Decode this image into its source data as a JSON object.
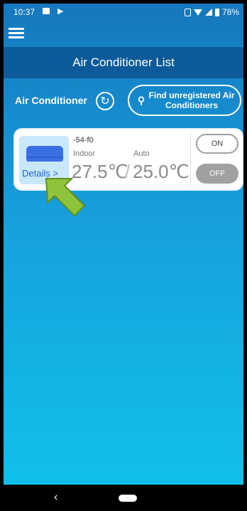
{
  "status": {
    "time": "10:37",
    "battery": "78%"
  },
  "header": {
    "title": "Air Conditioner List"
  },
  "section": {
    "label": "Air Conditioner",
    "find_button": "Find unregistered Air Conditioners"
  },
  "unit": {
    "name": "-54-f0",
    "indoor_label": "Indoor",
    "indoor_temp": "27.5℃",
    "mode_label": "Auto",
    "set_temp": "25.0℃",
    "details": "Details >",
    "on_label": "ON",
    "off_label": "OFF"
  },
  "nav": {
    "back": "‹"
  }
}
